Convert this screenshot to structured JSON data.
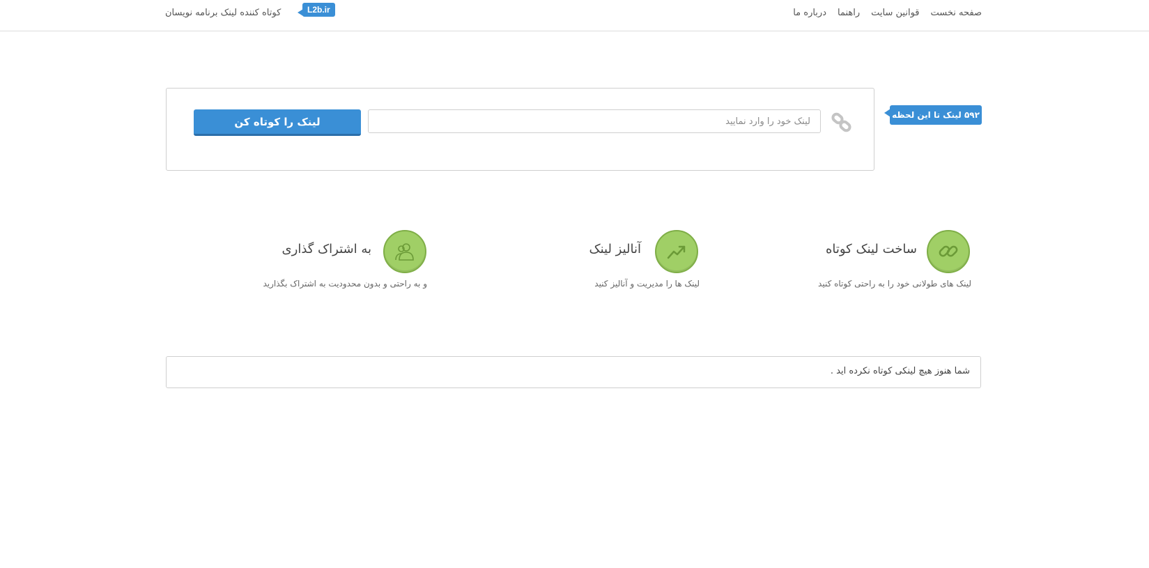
{
  "nav": {
    "links": [
      "صفحه نخست",
      "قوانین سایت",
      "راهنما",
      "درباره ما"
    ],
    "brand_text": "کوتاه کننده لینک برنامه نویسان",
    "brand_badge": "L2b.ir"
  },
  "shortener": {
    "counter_text": "۵۹۲ لینک تا این لحظه",
    "input_placeholder": "لینک خود را وارد نمایید",
    "input_value": "",
    "button_label": "لینک را کوتاه کن",
    "icon": "link-icon"
  },
  "features": [
    {
      "title": "ساخت لینک کوتاه",
      "description": "لینک های طولانی خود را به راحتی کوتاه کنید",
      "icon": "chain-link-icon"
    },
    {
      "title": "آنالیز لینک",
      "description": "لینک ها را مدیریت و آنالیز کنید",
      "icon": "trend-up-icon"
    },
    {
      "title": "به اشتراک گذاری",
      "description": "و به راحتی و بدون محدودیت به اشتراک بگذارید",
      "icon": "users-icon"
    }
  ],
  "message": {
    "text": "شما هنوز هیچ لینکی کوتاه نکرده اید ."
  },
  "colors": {
    "accent": "#3a8fd6",
    "feature_green": "#a0cf66",
    "border": "#cfcfcf"
  }
}
